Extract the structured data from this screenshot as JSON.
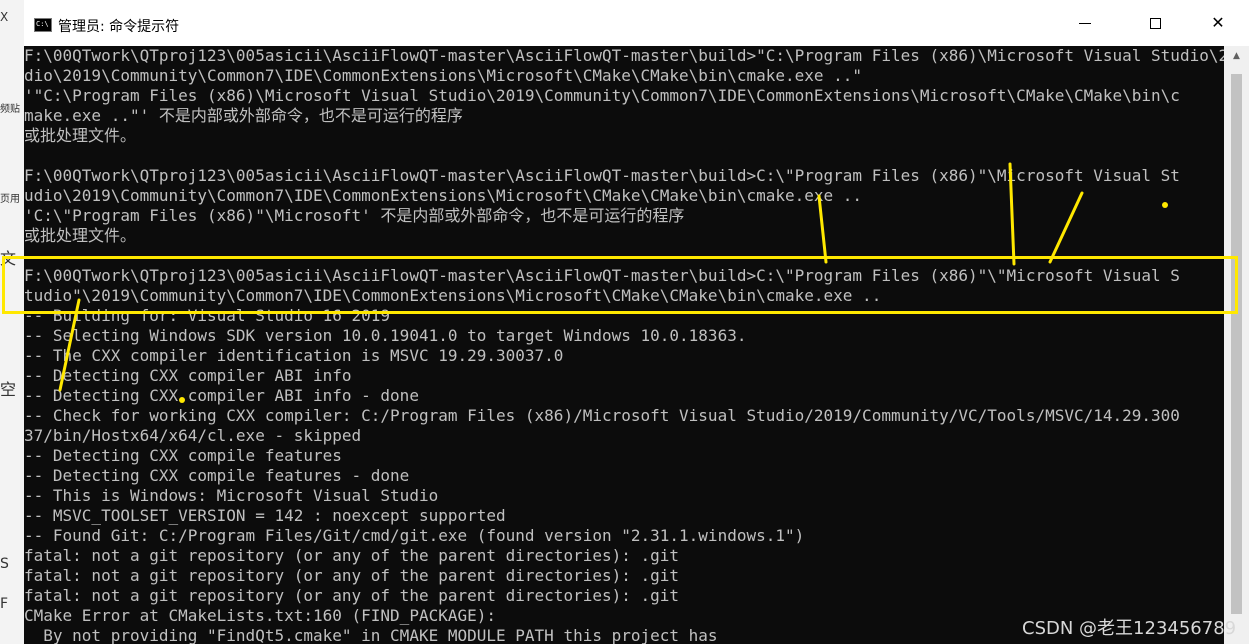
{
  "window": {
    "title": "管理员: 命令提示符",
    "icon_label": "C:\\",
    "minimize_icon": "minimize-icon",
    "maximize_icon": "maximize-icon",
    "close_icon": "close-icon"
  },
  "console_lines": [
    "F:\\00QTwork\\QTproj123\\005asicii\\AsciiFlowQT-master\\AsciiFlowQT-master\\build>\"C:\\Program Files (x86)\\Microsoft Visual Studio\\2019\\Community\\Common7\\IDE\\CommonExtensions\\Microsoft\\CMake\\CMake\\bin\\cmake.exe ..\"",
    "dio\\2019\\Community\\Common7\\IDE\\CommonExtensions\\Microsoft\\CMake\\CMake\\bin\\cmake.exe ..\"",
    "'\"C:\\Program Files (x86)\\Microsoft Visual Studio\\2019\\Community\\Common7\\IDE\\CommonExtensions\\Microsoft\\CMake\\CMake\\bin\\c",
    "make.exe ..\"' 不是内部或外部命令，也不是可运行的程序",
    "或批处理文件。",
    "",
    "F:\\00QTwork\\QTproj123\\005asicii\\AsciiFlowQT-master\\AsciiFlowQT-master\\build>C:\\\"Program Files (x86)\"\\Microsoft Visual St",
    "udio\\2019\\Community\\Common7\\IDE\\CommonExtensions\\Microsoft\\CMake\\CMake\\bin\\cmake.exe ..",
    "'C:\\\"Program Files (x86)\"\\Microsoft' 不是内部或外部命令，也不是可运行的程序",
    "或批处理文件。",
    "",
    "F:\\00QTwork\\QTproj123\\005asicii\\AsciiFlowQT-master\\AsciiFlowQT-master\\build>C:\\\"Program Files (x86)\"\\\"Microsoft Visual S",
    "tudio\"\\2019\\Community\\Common7\\IDE\\CommonExtensions\\Microsoft\\CMake\\CMake\\bin\\cmake.exe ..",
    "-- Building for: Visual Studio 16 2019",
    "-- Selecting Windows SDK version 10.0.19041.0 to target Windows 10.0.18363.",
    "-- The CXX compiler identification is MSVC 19.29.30037.0",
    "-- Detecting CXX compiler ABI info",
    "-- Detecting CXX compiler ABI info - done",
    "-- Check for working CXX compiler: C:/Program Files (x86)/Microsoft Visual Studio/2019/Community/VC/Tools/MSVC/14.29.300",
    "37/bin/Hostx64/x64/cl.exe - skipped",
    "-- Detecting CXX compile features",
    "-- Detecting CXX compile features - done",
    "-- This is Windows: Microsoft Visual Studio",
    "-- MSVC_TOOLSET_VERSION = 142 : noexcept supported",
    "-- Found Git: C:/Program Files/Git/cmd/git.exe (found version \"2.31.1.windows.1\")",
    "fatal: not a git repository (or any of the parent directories): .git",
    "fatal: not a git repository (or any of the parent directories): .git",
    "fatal: not a git repository (or any of the parent directories): .git",
    "CMake Error at CMakeLists.txt:160 (FIND_PACKAGE):",
    "  By not providing \"FindQt5.cmake\" in CMAKE_MODULE_PATH this project has"
  ],
  "background_app_glyphs": [
    "X",
    "频贴",
    "页用",
    "文",
    "空",
    "S",
    "F"
  ],
  "watermark": "CSDN @老王123456789",
  "colors": {
    "console_bg": "#0c0c0c",
    "console_text": "#c0c0c0",
    "annotation": "#ffe800"
  }
}
